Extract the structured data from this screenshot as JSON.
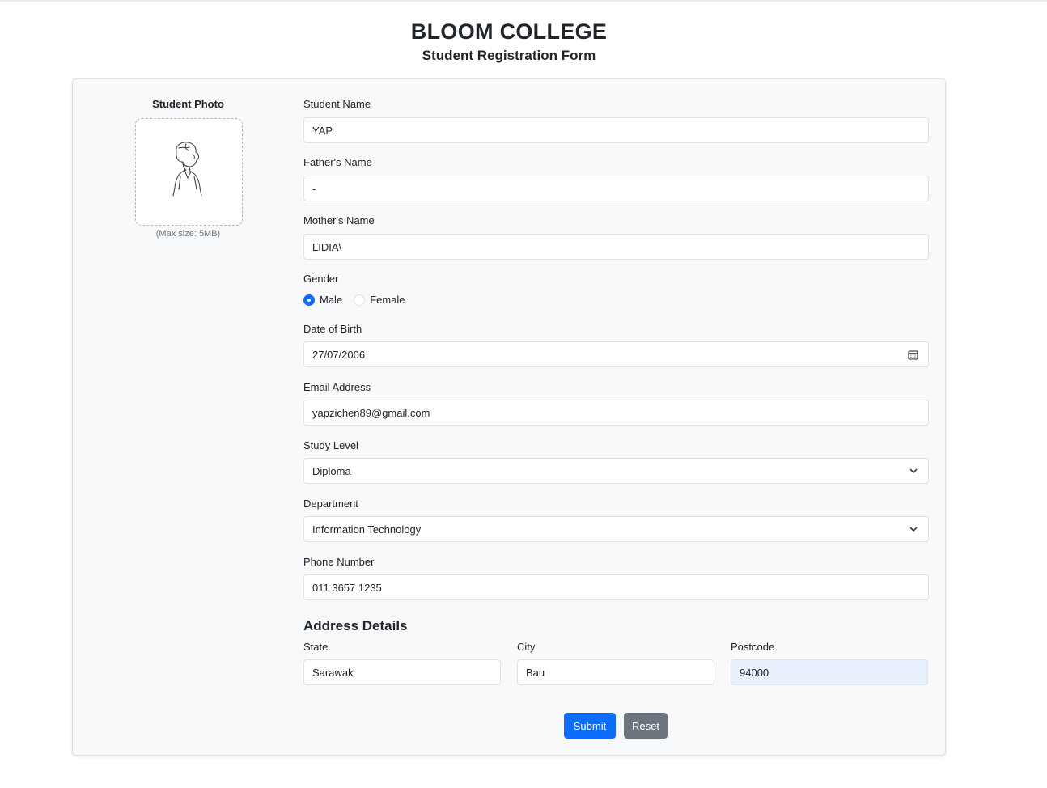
{
  "header": {
    "college": "BLOOM COLLEGE",
    "form_title": "Student Registration Form"
  },
  "photo": {
    "label": "Student Photo",
    "note": "(Max size: 5MB)",
    "icon": "student-photo-placeholder-icon"
  },
  "fields": {
    "student_name": {
      "label": "Student Name",
      "value": "YAP"
    },
    "father_name": {
      "label": "Father's Name",
      "value": "-"
    },
    "mother_name": {
      "label": "Mother's Name",
      "value": "LIDIA\\"
    },
    "gender": {
      "label": "Gender",
      "options": [
        "Male",
        "Female"
      ],
      "selected": "Male"
    },
    "dob": {
      "label": "Date of Birth",
      "value": "27/07/2006",
      "icon": "calendar-icon"
    },
    "email": {
      "label": "Email Address",
      "value": "yapzichen89@gmail.com"
    },
    "study_level": {
      "label": "Study Level",
      "value": "Diploma",
      "icon": "chevron-down-icon"
    },
    "department": {
      "label": "Department",
      "value": "Information Technology",
      "icon": "chevron-down-icon"
    },
    "phone": {
      "label": "Phone Number",
      "value": "011 3657 1235"
    }
  },
  "address": {
    "title": "Address Details",
    "state": {
      "label": "State",
      "value": "Sarawak"
    },
    "city": {
      "label": "City",
      "value": "Bau"
    },
    "postcode": {
      "label": "Postcode",
      "value": "94000"
    }
  },
  "actions": {
    "submit": "Submit",
    "reset": "Reset"
  },
  "colors": {
    "primary": "#0d6efd",
    "secondary": "#6c757d",
    "card_bg": "#f8f9fa",
    "autofill_bg": "#e8f0fe"
  }
}
